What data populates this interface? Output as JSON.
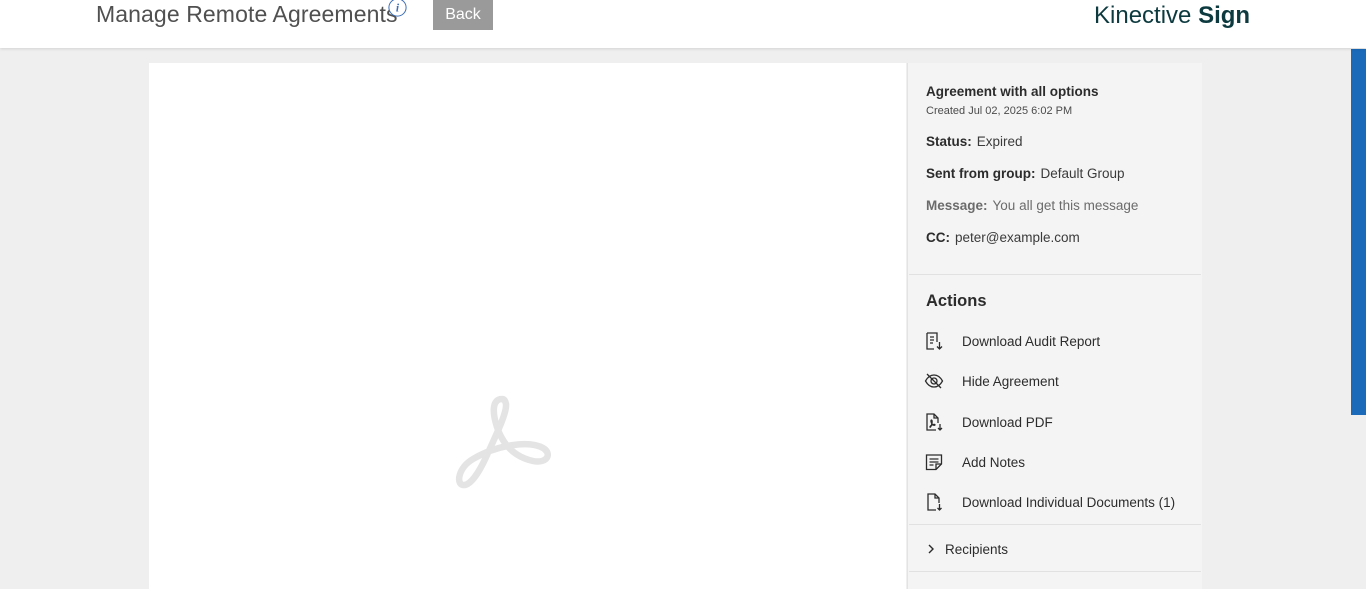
{
  "header": {
    "title": "Manage Remote Agreements",
    "info_icon": "info-icon",
    "back_label": "Back",
    "brand_light": "Kinective",
    "brand_bold": "Sign"
  },
  "colors": {
    "brand": "#0c3a3f",
    "scroll_accent": "#1b6ab9",
    "back_button": "#9a9a9a"
  },
  "document": {
    "placeholder_icon": "acrobat-logo-icon"
  },
  "agreement": {
    "name": "Agreement with all options",
    "created": "Created Jul 02, 2025 6:02 PM",
    "status_label": "Status:",
    "status_value": "Expired",
    "group_label": "Sent from group:",
    "group_value": "Default Group",
    "message_label": "Message:",
    "message_value": "You all get this message",
    "cc_label": "CC:",
    "cc_value": "peter@example.com"
  },
  "actions": {
    "heading": "Actions",
    "items": [
      {
        "label": "Download Audit Report",
        "icon": "audit-report-icon"
      },
      {
        "label": "Hide Agreement",
        "icon": "eye-off-icon"
      },
      {
        "label": "Download PDF",
        "icon": "pdf-download-icon"
      },
      {
        "label": "Add Notes",
        "icon": "notes-icon"
      },
      {
        "label": "Download Individual Documents (1)",
        "icon": "document-download-icon"
      }
    ]
  },
  "recipients": {
    "label": "Recipients",
    "icon": "chevron-right-icon"
  }
}
